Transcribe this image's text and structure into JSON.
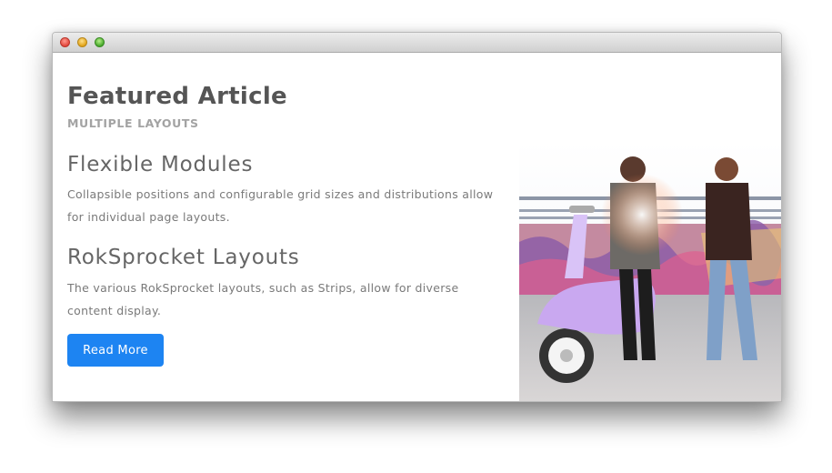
{
  "window": {
    "traffic_lights": [
      "close",
      "minimize",
      "zoom"
    ]
  },
  "article": {
    "title": "Featured Article",
    "subtitle": "MULTIPLE LAYOUTS",
    "sections": [
      {
        "heading": "Flexible Modules",
        "body": "Collapsible positions and configurable grid sizes and distributions allow for individual page layouts."
      },
      {
        "heading": "RokSprocket Layouts",
        "body": "The various RokSprocket layouts, such as Strips, allow for diverse content display."
      }
    ],
    "button_label": "Read More"
  },
  "colors": {
    "accent": "#1d84f2",
    "title": "#555555",
    "subtitle": "#a3a3a3",
    "body_text": "#7a7a7a"
  },
  "image": {
    "subject": "photo-two-people-with-scooter"
  }
}
